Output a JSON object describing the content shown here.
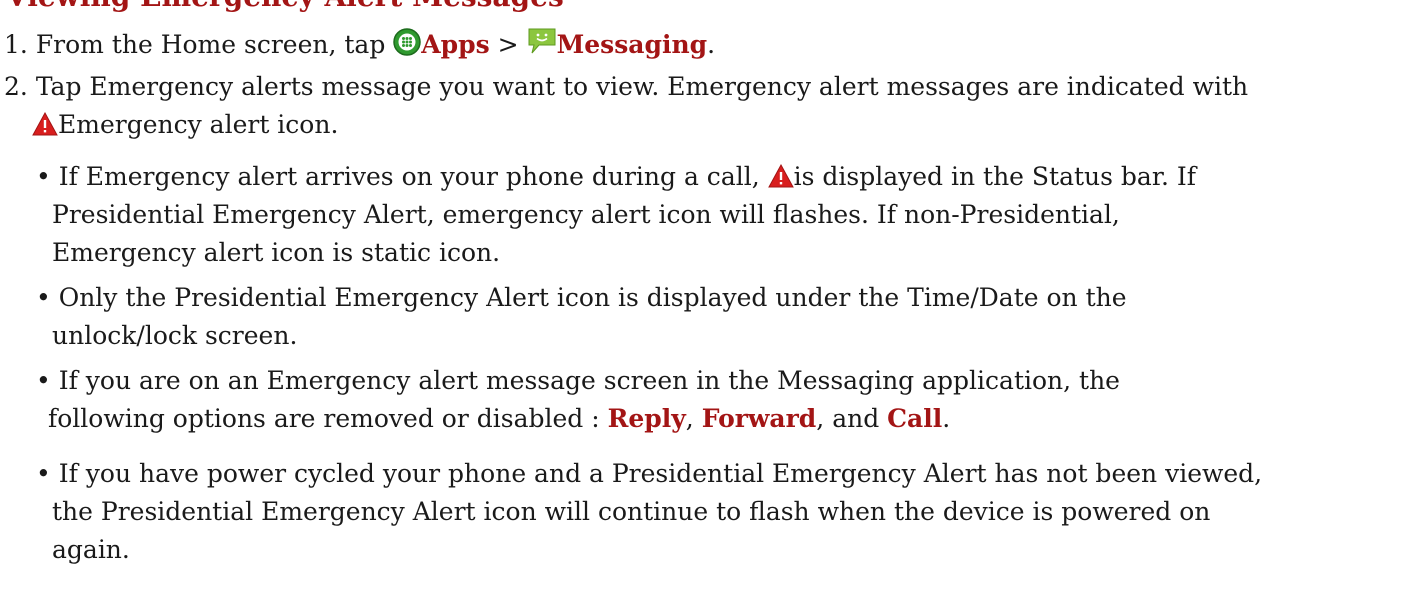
{
  "heading": {
    "partial_text": "Viewing Emergency Alert Messages"
  },
  "steps": [
    {
      "number": "1.",
      "prefix": "From the Home screen, tap",
      "apps_label": "Apps",
      "separator": ">",
      "messaging_label": "Messaging",
      "suffix": "."
    },
    {
      "number": "2.",
      "line1": "Tap Emergency alerts message you want to view. Emergency alert messages are indicated with",
      "line2_text": "Emergency alert icon."
    }
  ],
  "bullets": [
    {
      "bullet": "•",
      "line1_prefix": "If Emergency alert arrives on your phone during a call,",
      "line1_suffix": "is displayed in the Status bar. If",
      "line2": "Presidential Emergency Alert, emergency alert icon will flashes. If non-Presidential,",
      "line3": "Emergency alert icon is static icon."
    },
    {
      "bullet": "•",
      "line1": "Only the Presidential Emergency Alert icon is displayed under the Time/Date on the",
      "line2": "unlock/lock screen."
    },
    {
      "bullet": "•",
      "line1": "If you are on an Emergency alert message screen in the Messaging application, the",
      "line2_prefix": "following options are removed or disabled :",
      "reply": "Reply",
      "comma1": ",",
      "forward": "Forward",
      "and": ", and",
      "call": "Call",
      "period": "."
    },
    {
      "bullet": "•",
      "line1": "If you have power cycled your phone and a Presidential Emergency Alert has not been viewed,",
      "line2": "the Presidential Emergency Alert icon will continue to flash when the device is powered on",
      "line3": "again."
    }
  ],
  "icons": {
    "apps": "apps-icon",
    "messaging": "messaging-icon",
    "alert": "emergency-alert-icon"
  },
  "colors": {
    "accent_red": "#a31515",
    "text": "#1a1a1a",
    "apps_green": "#2f9a2f",
    "messaging_green": "#8cc63f",
    "alert_red": "#d81e1e"
  }
}
